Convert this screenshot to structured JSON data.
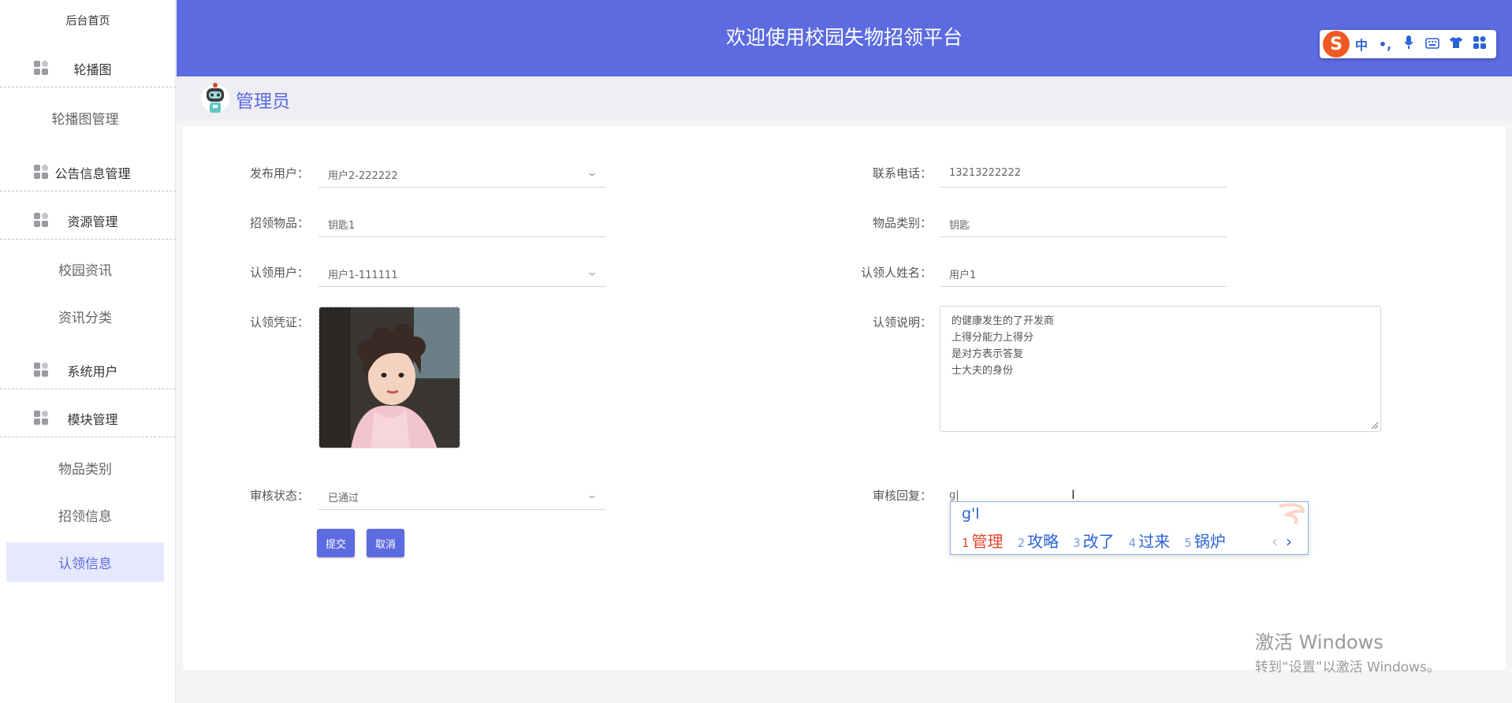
{
  "sidebar": {
    "home": "后台首页",
    "groups": [
      {
        "label": "轮播图"
      },
      {
        "label": "公告信息管理"
      },
      {
        "label": "资源管理"
      },
      {
        "label": "系统用户"
      },
      {
        "label": "模块管理"
      }
    ],
    "items": [
      {
        "label": "轮播图管理"
      },
      {
        "label": "校园资讯"
      },
      {
        "label": "资讯分类"
      },
      {
        "label": "物品类别"
      },
      {
        "label": "招领信息"
      },
      {
        "label": "认领信息"
      }
    ]
  },
  "header": {
    "title": "欢迎使用校园失物招领平台"
  },
  "ime_toolbar": {
    "logo": "S",
    "mode": "中",
    "punct": "•,",
    "mic": "🎤",
    "keyboard": "⌨",
    "skin": "👕",
    "apps": "▦"
  },
  "subheader": {
    "role": "管理员"
  },
  "form": {
    "publisher": {
      "label": "发布用户：",
      "value": "用户2-222222"
    },
    "phone": {
      "label": "联系电话：",
      "value": "13213222222"
    },
    "item": {
      "label": "招领物品：",
      "value": "钥匙1"
    },
    "category": {
      "label": "物品类别：",
      "value": "钥匙"
    },
    "claimer": {
      "label": "认领用户：",
      "value": "用户1-111111"
    },
    "claimer_name": {
      "label": "认领人姓名：",
      "value": "用户1"
    },
    "proof": {
      "label": "认领凭证："
    },
    "description": {
      "label": "认领说明：",
      "lines": [
        "的健康发生的了开发商",
        "上得分能力上得分",
        "是对方表示答复",
        "士大夫的身份"
      ]
    },
    "status": {
      "label": "审核状态：",
      "value": "已通过"
    },
    "reply": {
      "label": "审核回复：",
      "value": "g|"
    },
    "submit": "提交",
    "cancel": "取消"
  },
  "ime_popup": {
    "code": "g'l",
    "candidates": [
      {
        "n": "1",
        "text": "管理"
      },
      {
        "n": "2",
        "text": "攻略"
      },
      {
        "n": "3",
        "text": "改了"
      },
      {
        "n": "4",
        "text": "过来"
      },
      {
        "n": "5",
        "text": "锅炉"
      }
    ],
    "prev": "‹",
    "next": "›"
  },
  "watermark": {
    "line1": "激活 Windows",
    "line2": "转到“设置”以激活 Windows。"
  },
  "colors": {
    "primary": "#5c6be0",
    "active_bg": "#e6e8fb"
  }
}
